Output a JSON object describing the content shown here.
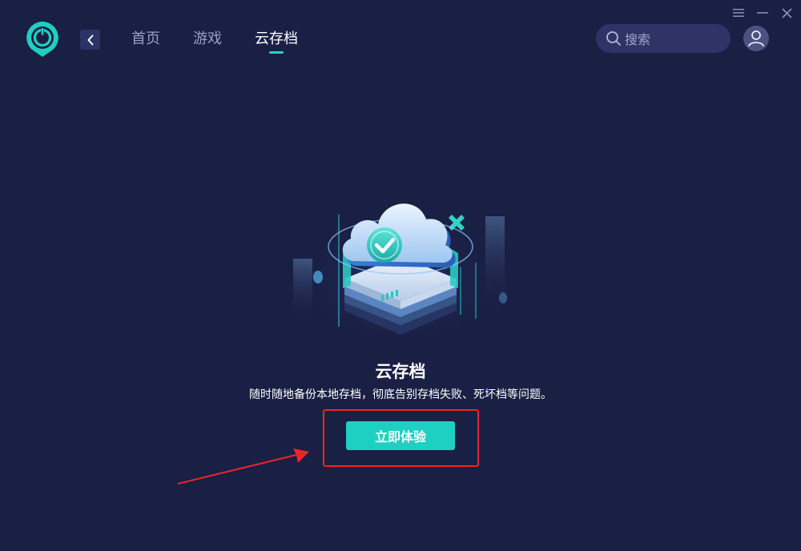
{
  "window": {
    "menu_icon": "menu-icon",
    "minimize_icon": "minimize-icon",
    "close_icon": "close-icon"
  },
  "header": {
    "logo_icon": "app-logo-icon",
    "back_icon": "chevron-left-icon",
    "tabs": [
      {
        "label": "首页",
        "active": false
      },
      {
        "label": "游戏",
        "active": false
      },
      {
        "label": "云存档",
        "active": true
      }
    ],
    "search": {
      "placeholder": "搜索",
      "icon": "search-icon"
    },
    "avatar_icon": "user-icon"
  },
  "main": {
    "illustration": "cloud-save-illustration",
    "title": "云存档",
    "description": "随时随地备份本地存档，彻底告别存档失败、死坏档等问题。",
    "cta_label": "立即体验"
  },
  "annotation": {
    "highlight_color": "#e8262a",
    "arrow": "red-arrow"
  },
  "colors": {
    "background": "#1a1f44",
    "accent": "#1ed0c2",
    "tab_inactive": "#9aa0c6"
  }
}
